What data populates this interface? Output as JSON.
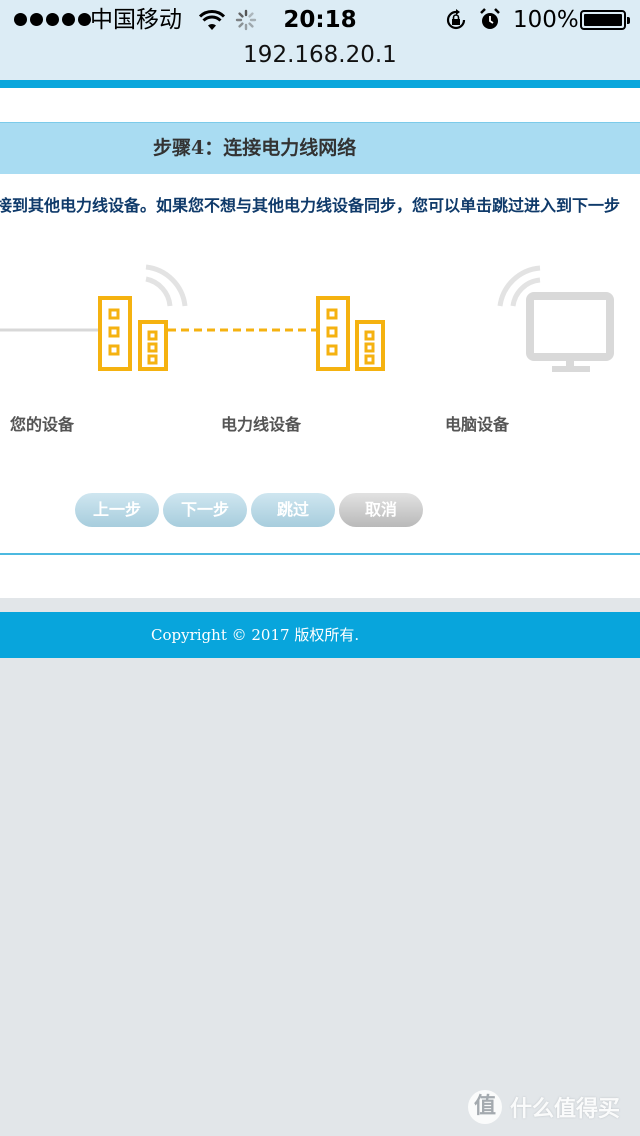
{
  "status_bar": {
    "carrier": "中国移动",
    "time": "20:18",
    "battery": "100%",
    "battery_level": 1.0
  },
  "address_bar": {
    "url": "192.168.20.1"
  },
  "wizard": {
    "step_title": "步骤4：连接电力线网络",
    "instruction": "接到其他电力线设备。如果您不想与其他电力线设备同步，您可以单击跳过进入到下一步",
    "diagram_labels": [
      "您的设备",
      "电力线设备",
      "电脑设备"
    ],
    "buttons": {
      "prev": "上一步",
      "next": "下一步",
      "skip": "跳过",
      "cancel": "取消"
    }
  },
  "footer": {
    "copyright": "Copyright © 2017 版权所有."
  },
  "watermark": {
    "glyph": "值",
    "text": "什么值得买"
  },
  "colors": {
    "header_stripe": "#0aa6dc",
    "step_bar": "#a9dcf2",
    "device_icon": "#f5b210",
    "computer_icon": "#d9d9d9",
    "instruction_text": "#0f3a6a",
    "footer": "#08a5dc"
  }
}
